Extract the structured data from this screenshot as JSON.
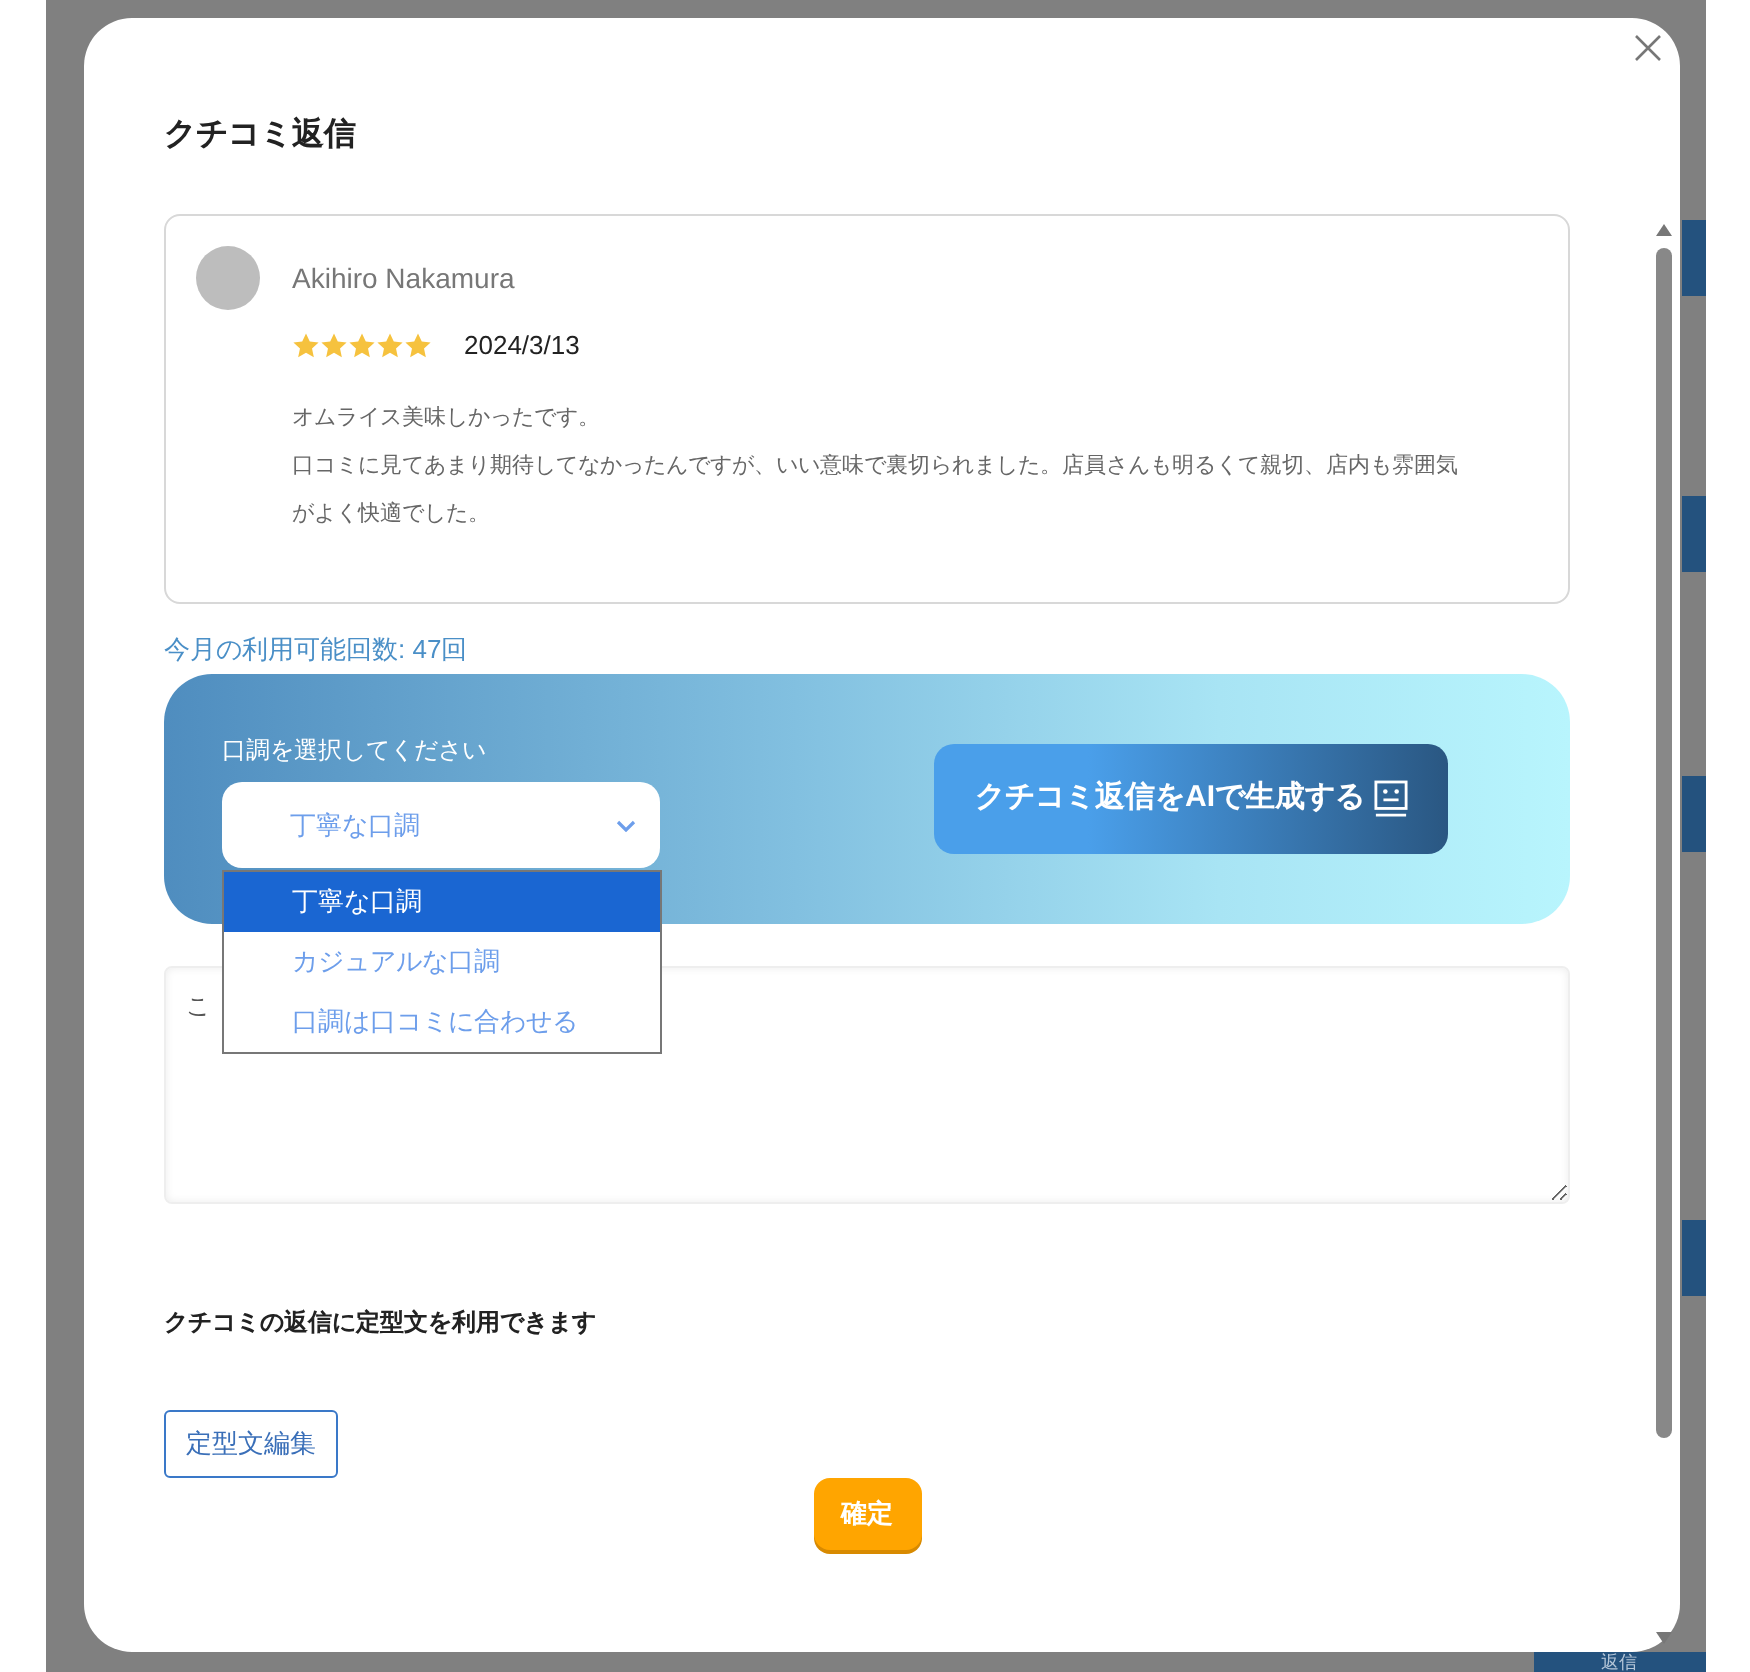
{
  "background": {
    "reply_button": "返信"
  },
  "dialog": {
    "title": "クチコミ返信",
    "review": {
      "reviewer": "Akihiro Nakamura",
      "stars": 5,
      "date": "2024/3/13",
      "text_lines": [
        "オムライス美味しかったです。",
        "口コミに見てあまり期待してなかったんですが、いい意味で裏切られました。店員さんも明るくて親切、店内も雰囲気",
        "がよく快適でした。"
      ]
    },
    "usage": "今月の利用可能回数: 47回",
    "tone": {
      "label": "口調を選択してください",
      "value": "丁寧な口調",
      "open": true,
      "options": [
        {
          "label": "丁寧な口調",
          "selected": true
        },
        {
          "label": "カジュアルな口調",
          "selected": false
        },
        {
          "label": "口調は口コミに合わせる",
          "selected": false
        }
      ]
    },
    "generate_button": "クチコミ返信をAIで生成する",
    "reply_field": {
      "placeholder": "こ"
    },
    "template_note": "クチコミの返信に定型文を利用できます",
    "template_button": "定型文編集",
    "confirm_button": "確定"
  }
}
